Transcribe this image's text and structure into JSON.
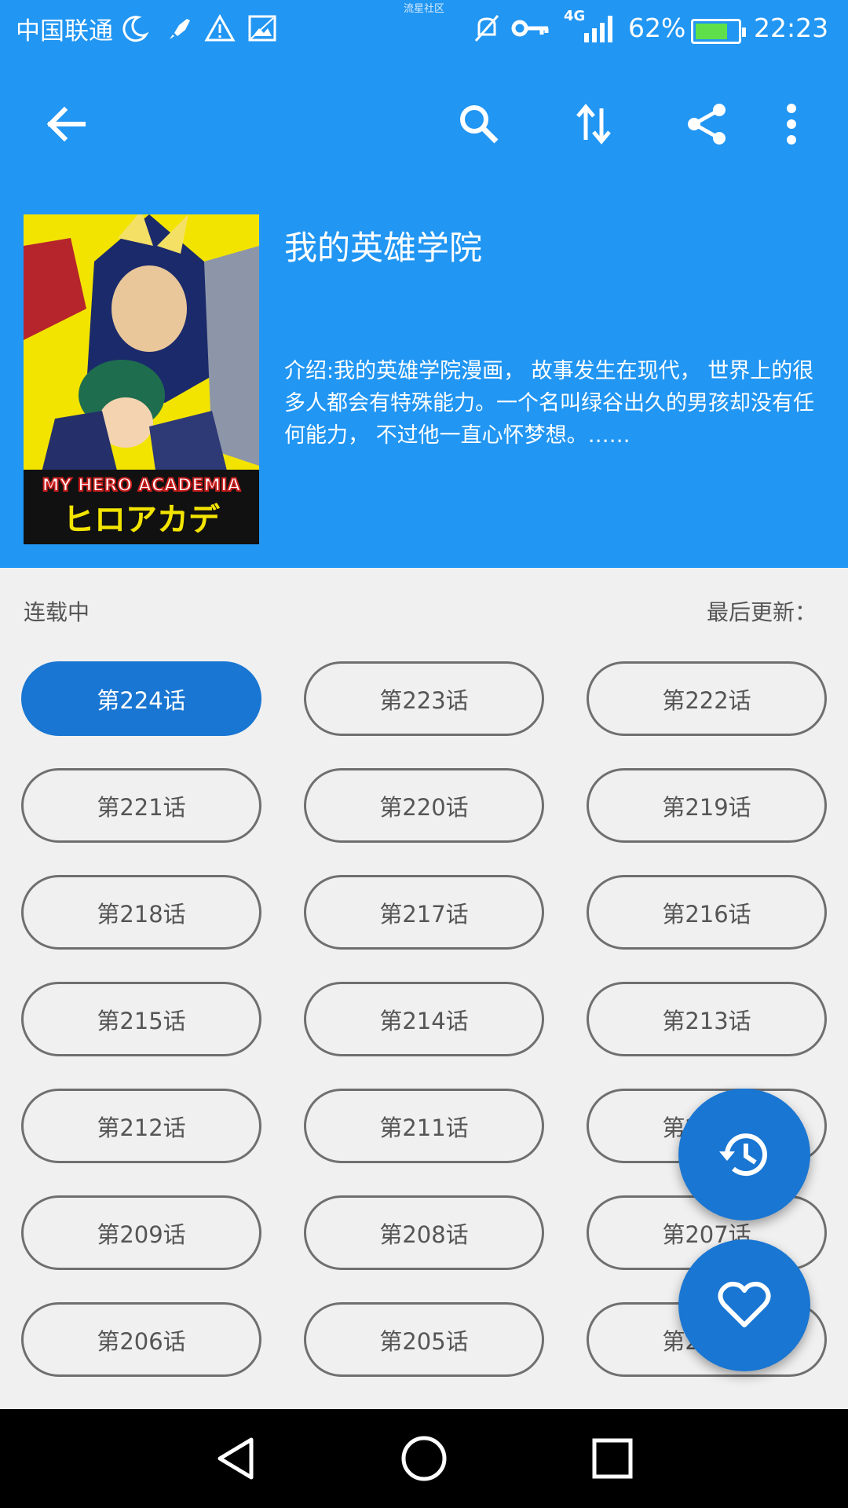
{
  "status_bar": {
    "carrier": "中国联通",
    "watermark": "流星社区",
    "network": "4G",
    "battery": "62%",
    "battery_level": 0.62,
    "time": "22:23",
    "icons": [
      "moon-icon",
      "rocket-icon",
      "warning-icon",
      "image-icon",
      "mute-icon",
      "vpn-key-icon",
      "signal-icon",
      "battery-icon"
    ]
  },
  "toolbar": {
    "icons": [
      "back-arrow-icon",
      "search-icon",
      "sort-icon",
      "share-icon",
      "more-icon"
    ]
  },
  "comic": {
    "title": "我的英雄学院",
    "description": "介绍:我的英雄学院漫画， 故事发生在现代，  世界上的很多人都会有特殊能力。一个名叫绿谷出久的男孩却没有任何能力，  不过他一直心怀梦想。……",
    "cover_text": "MY HERO ACADEMIA",
    "cover_text_jp": "ヒロアカデ"
  },
  "status_row": {
    "serial_status": "连载中",
    "last_update": "最后更新："
  },
  "chapters": [
    "第224话",
    "第223话",
    "第222话",
    "第221话",
    "第220话",
    "第219话",
    "第218话",
    "第217话",
    "第216话",
    "第215话",
    "第214话",
    "第213话",
    "第212话",
    "第211话",
    "第210话",
    "第209话",
    "第208话",
    "第207话",
    "第206话",
    "第205话",
    "第204话"
  ],
  "active_chapter": "第224话",
  "fab": {
    "icons": [
      "history-icon",
      "heart-icon"
    ]
  },
  "nav": {
    "icons": [
      "nav-back-icon",
      "nav-home-icon",
      "nav-recents-icon"
    ]
  },
  "colors": {
    "primary": "#2196f3",
    "accent": "#1976d2",
    "background": "#f0f0f0"
  }
}
